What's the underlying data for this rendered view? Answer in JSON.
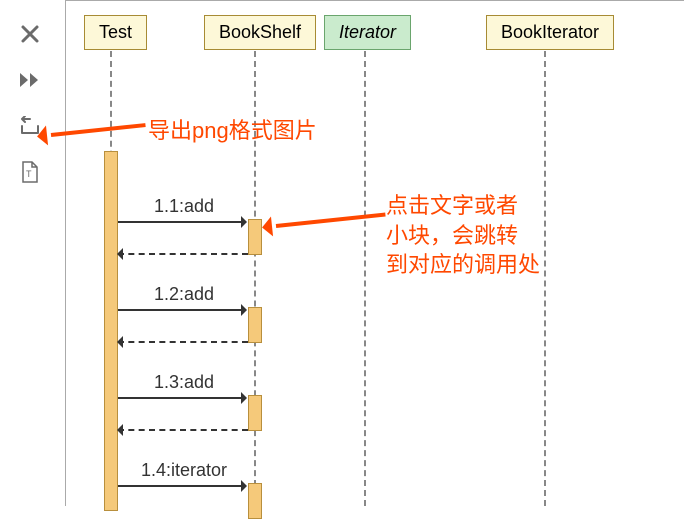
{
  "toolbar": {
    "close": "close",
    "skip": "skip",
    "export": "export-png",
    "text": "text-file"
  },
  "participants": [
    {
      "label": "Test",
      "italic": false
    },
    {
      "label": "BookShelf",
      "italic": false
    },
    {
      "label": "Iterator",
      "italic": true
    },
    {
      "label": "BookIterator",
      "italic": false
    }
  ],
  "messages": [
    {
      "label": "1.1:add"
    },
    {
      "label": "1.2:add"
    },
    {
      "label": "1.3:add"
    },
    {
      "label": "1.4:iterator"
    }
  ],
  "annotations": {
    "export": "导出png格式图片",
    "click": "点击文字或者\n小块，会跳转\n到对应的调用处"
  },
  "colors": {
    "accent": "#ff4800",
    "participantBg": "#fdf8d8",
    "participantItalicBg": "#caebcd",
    "activation": "#f5c97a"
  }
}
